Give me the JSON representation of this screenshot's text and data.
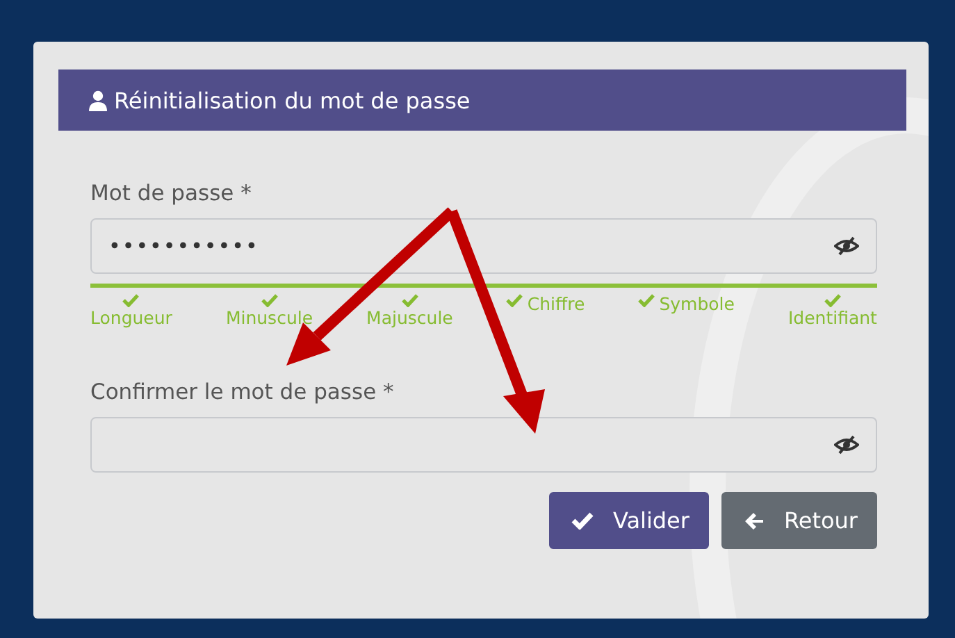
{
  "panel": {
    "title": "Réinitialisation du mot de passe"
  },
  "password": {
    "label": "Mot de passe *",
    "value": "•••••••••••"
  },
  "rules": [
    {
      "label": "Longueur",
      "met": true,
      "kind": "stacked"
    },
    {
      "label": "Minuscule",
      "met": true,
      "kind": "stacked"
    },
    {
      "label": "Majuscule",
      "met": true,
      "kind": "stacked"
    },
    {
      "label": "Chiffre",
      "met": true,
      "kind": "inline"
    },
    {
      "label": "Symbole",
      "met": true,
      "kind": "inline"
    },
    {
      "label": "Identifiant",
      "met": true,
      "kind": "stacked"
    }
  ],
  "confirm": {
    "label": "Confirmer le mot de passe *"
  },
  "buttons": [
    {
      "label": "Valider",
      "kind": "primary"
    },
    {
      "label": "Retour",
      "kind": "back"
    }
  ]
}
